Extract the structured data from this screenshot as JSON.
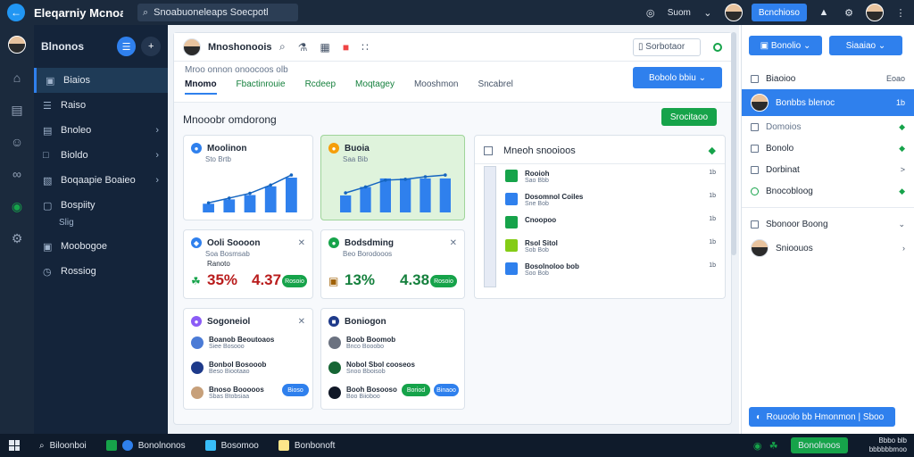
{
  "titlebar": {
    "title": "Eleqarniy Mcnoa",
    "search_value": "Snoabuoneleaps Soecpotl",
    "user_label": "Suom",
    "action_label": "Bcnchioso"
  },
  "sidebar": {
    "title": "Blnonos",
    "items": [
      {
        "label": "Biaios",
        "icon": "home-icon",
        "active": true
      },
      {
        "label": "Raiso",
        "icon": "list-icon"
      },
      {
        "label": "Bnoleo",
        "icon": "doc-icon",
        "chevron": true
      },
      {
        "label": "Bioldo",
        "icon": "tag-icon",
        "chevron": true
      },
      {
        "label": "Boqaapie Boaieo",
        "icon": "plug-icon",
        "chevron": true
      },
      {
        "label": "Bospiity",
        "icon": "box-icon"
      },
      {
        "label": "Moobogoe",
        "icon": "mail-icon"
      },
      {
        "label": "Rossiog",
        "icon": "clock-icon"
      }
    ],
    "sub_label": "Slig"
  },
  "main": {
    "header_name": "Mnoshonoois",
    "search_label": "Sorbotaor",
    "breadcrumb": "Mroo onnon onoocoos olb",
    "tabs": [
      "Mnomo",
      "Fbactinrouie",
      "Rcdeep",
      "Moqtagey",
      "Mooshmon",
      "Sncabrel"
    ],
    "primary_button": "Bobolo bbiu",
    "section_title": "Mnooobr omdorong",
    "section_button": "Srocitaoo"
  },
  "cards": {
    "chart1": {
      "title": "Moolinon",
      "meta": "Sto Brtb"
    },
    "chart2": {
      "title": "Buoia",
      "meta": "Saa Bib"
    },
    "stat1": {
      "title": "Ooli Soooon",
      "meta": "Soa Bosmsab",
      "sub": "Ranoto",
      "value": "35%",
      "value2": "4.37",
      "pill": "Rosoio"
    },
    "stat2": {
      "title": "Bodsdming",
      "meta": "Beo Borodooos",
      "value": "13%",
      "value2": "4.38",
      "pill": "Rosoio"
    },
    "people1": {
      "title": "Sogoneiol",
      "rows": [
        {
          "t1": "Boanob Beoutoaos",
          "t2": "Siee Bosooo"
        },
        {
          "t1": "Bonbol Bosooob",
          "t2": "Beso Biootaao"
        },
        {
          "t1": "Bnoso Booooos",
          "t2": "Sbas Btobsiaa"
        }
      ],
      "button": "Bioso"
    },
    "people2": {
      "title": "Boniogon",
      "rows": [
        {
          "t1": "Boob Boomob",
          "t2": "Bnco Booobo"
        },
        {
          "t1": "Nobol Sbol cooseos",
          "t2": "Snoo Bboisob"
        },
        {
          "t1": "Booh Bosooso",
          "t2": "Boo Biioboo"
        }
      ],
      "button1": "Boriod",
      "button2": "Binaoo"
    },
    "list": {
      "title": "Mneoh snooioos",
      "rows": [
        {
          "t1": "Rooioh",
          "t2": "Sao Bbb",
          "num": "1b"
        },
        {
          "t1": "Dosomnol Coiles",
          "t2": "Sne Bob",
          "num": "1b"
        },
        {
          "t1": "Cnoopoo",
          "t2": "",
          "num": "1b"
        },
        {
          "t1": "Rsol Sitol",
          "t2": "Sob Bob",
          "num": "1b"
        },
        {
          "t1": "Bosolnoloo bob",
          "t2": "Soo Bob",
          "num": "1b"
        }
      ]
    }
  },
  "chart_data": [
    {
      "type": "bar",
      "values": [
        2,
        3,
        4,
        6,
        8
      ],
      "line": [
        2.2,
        3.3,
        4.4,
        6.3,
        8.6
      ]
    },
    {
      "type": "bar",
      "values": [
        2,
        3,
        4,
        4,
        4,
        4
      ],
      "line": [
        2.3,
        3.0,
        3.8,
        3.9,
        4.2,
        4.4
      ]
    }
  ],
  "right": {
    "button1": "Bonolio",
    "button2": "Siaaiao",
    "header": "Biaoioo",
    "header_end": "Eoao",
    "rows": [
      {
        "label": "Bonbbs blenoc",
        "end": "1b",
        "active": true
      },
      {
        "label": "Domoios",
        "end": ""
      },
      {
        "label": "Bonolo",
        "end": ""
      },
      {
        "label": "Dorbinat",
        "end": ">"
      },
      {
        "label": "Bnocobloog",
        "end": ""
      }
    ],
    "group_label": "Sbonoor Boong",
    "group_row": "Snioouos",
    "bottom_button": "Rouoolo bb Hmonmon | Sboo"
  },
  "taskbar": {
    "search": "Biloonboi",
    "app1": "Bonolnonos",
    "app2": "Bosomoo",
    "app3": "Bonbonoft",
    "green_button": "Bonolnoos",
    "time": "Bbbo blb",
    "date": "bbbbbbmoo"
  },
  "colors": {
    "accent": "#2f80ed",
    "positive": "#16a34a",
    "sidebar": "#14243a",
    "titlebar": "#1b2a3d"
  }
}
